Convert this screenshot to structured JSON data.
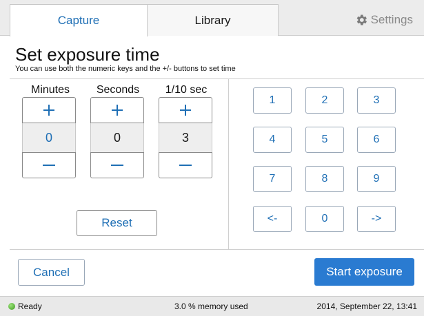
{
  "tabs": {
    "capture": "Capture",
    "library": "Library",
    "settings": "Settings"
  },
  "heading": {
    "title": "Set exposure time",
    "subtitle": "You can use both the numeric keys and the +/- buttons to set time"
  },
  "steppers": [
    {
      "label": "Minutes",
      "value": "0"
    },
    {
      "label": "Seconds",
      "value": "0"
    },
    {
      "label": "1/10 sec",
      "value": "3"
    }
  ],
  "reset_label": "Reset",
  "keypad": [
    "1",
    "2",
    "3",
    "4",
    "5",
    "6",
    "7",
    "8",
    "9",
    "<-",
    "0",
    "->"
  ],
  "actions": {
    "cancel": "Cancel",
    "start": "Start exposure"
  },
  "status": {
    "state": "Ready",
    "memory": "3.0 % memory used",
    "datetime": "2014, September 22, 13:41"
  },
  "colors": {
    "accent": "#1f6fb5",
    "primary_button": "#2a7bd1",
    "ready_indicator": "#3c9a1f"
  }
}
